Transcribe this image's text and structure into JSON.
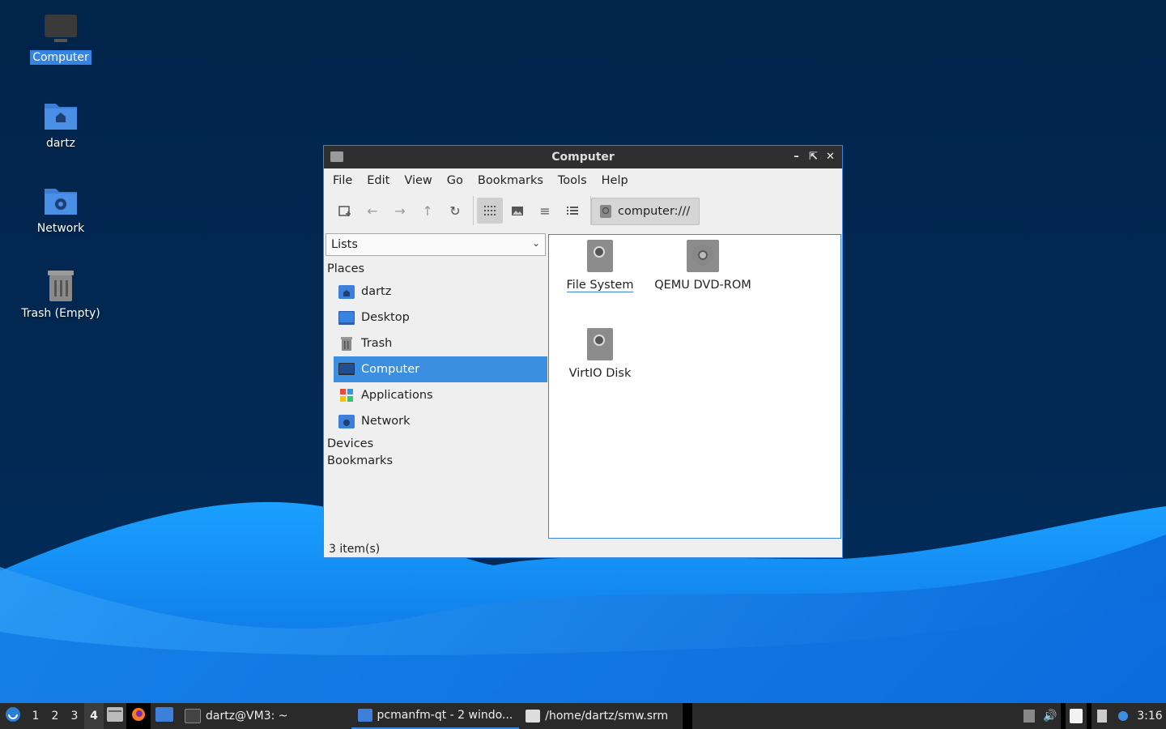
{
  "desktop": {
    "icons": [
      {
        "label": "Computer"
      },
      {
        "label": "dartz"
      },
      {
        "label": "Network"
      },
      {
        "label": "Trash (Empty)"
      }
    ]
  },
  "window": {
    "title": "Computer",
    "menu": [
      "File",
      "Edit",
      "View",
      "Go",
      "Bookmarks",
      "Tools",
      "Help"
    ],
    "path": "computer:///",
    "side_pane": {
      "mode": "Lists",
      "places_heading": "Places",
      "places": [
        {
          "label": "dartz",
          "icon": "home-folder-icon"
        },
        {
          "label": "Desktop",
          "icon": "desktop-icon"
        },
        {
          "label": "Trash",
          "icon": "trash-icon"
        },
        {
          "label": "Computer",
          "icon": "computer-icon",
          "selected": true
        },
        {
          "label": "Applications",
          "icon": "applications-icon"
        },
        {
          "label": "Network",
          "icon": "network-folder-icon"
        }
      ],
      "devices_heading": "Devices",
      "bookmarks_heading": "Bookmarks"
    },
    "items": [
      {
        "label": "File System",
        "icon": "drive-icon"
      },
      {
        "label": "QEMU DVD-ROM",
        "icon": "dvd-icon"
      },
      {
        "label": "VirtIO Disk",
        "icon": "drive-icon"
      }
    ],
    "status": "3 item(s)"
  },
  "taskbar": {
    "workspaces": [
      "1",
      "2",
      "3",
      "4"
    ],
    "active_workspace": "4",
    "tasks": [
      {
        "label": "dartz@VM3: ~"
      },
      {
        "label": "pcmanfm-qt - 2 windo..."
      },
      {
        "label": "/home/dartz/smw.srm"
      }
    ],
    "clock": "3:16"
  },
  "colors": {
    "desktop_dark": "#02264d",
    "wave_light": "#1a8ff0",
    "selection": "#3b8ee0",
    "titlebar": "#2f2f2f",
    "taskbar": "#2a2a2a"
  }
}
